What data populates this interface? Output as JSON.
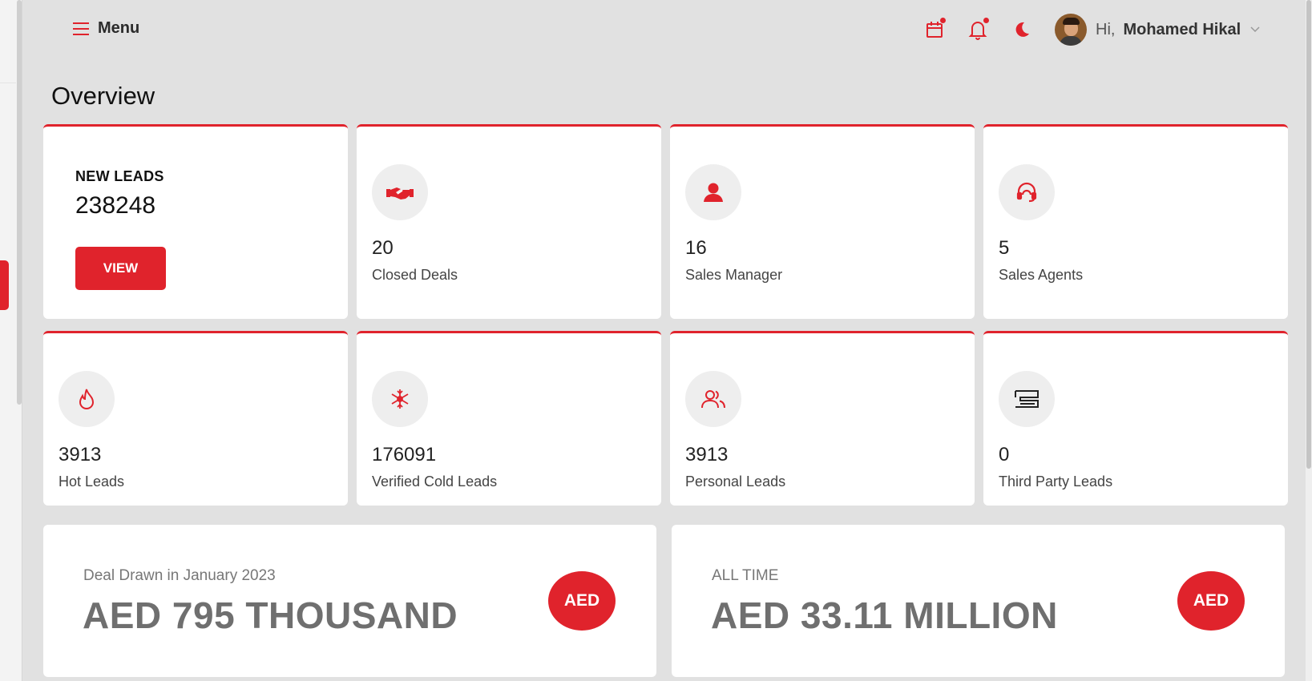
{
  "header": {
    "menu_label": "Menu",
    "greeting": "Hi,",
    "user_name": "Mohamed Hikal"
  },
  "page_title": "Overview",
  "new_leads": {
    "title": "NEW LEADS",
    "count": "238248",
    "button_label": "VIEW"
  },
  "stats_row1": [
    {
      "value": "20",
      "label": "Closed Deals",
      "icon": "handshake-icon"
    },
    {
      "value": "16",
      "label": "Sales Manager",
      "icon": "user-icon"
    },
    {
      "value": "5",
      "label": "Sales Agents",
      "icon": "headset-icon"
    }
  ],
  "stats_row2": [
    {
      "value": "3913",
      "label": "Hot Leads",
      "icon": "flame-icon"
    },
    {
      "value": "176091",
      "label": "Verified Cold Leads",
      "icon": "snowflake-icon"
    },
    {
      "value": "3913",
      "label": "Personal Leads",
      "icon": "users-icon"
    },
    {
      "value": "0",
      "label": "Third Party Leads",
      "icon": "third-party-icon"
    }
  ],
  "summary": [
    {
      "subtitle": "Deal Drawn in January 2023",
      "amount": "AED 795 THOUSAND",
      "badge": "AED"
    },
    {
      "subtitle": "ALL TIME",
      "amount": "AED 33.11 MILLION",
      "badge": "AED"
    }
  ],
  "colors": {
    "accent": "#e0232c",
    "background": "#e1e1e1",
    "card": "#ffffff"
  }
}
